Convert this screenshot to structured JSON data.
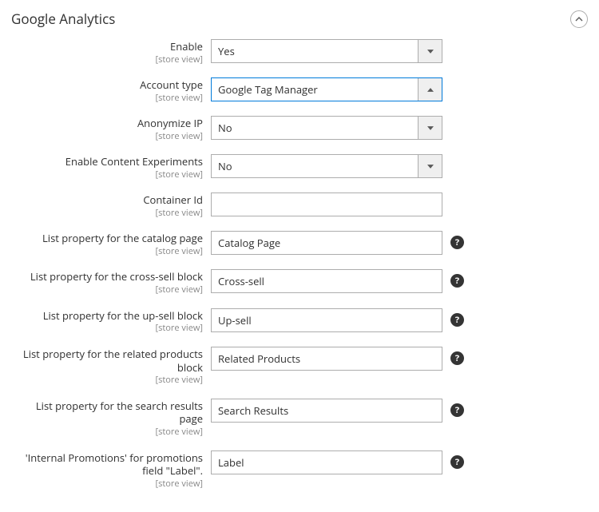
{
  "section": {
    "title": "Google Analytics"
  },
  "scope_text": "[store view]",
  "fields": {
    "enable": {
      "label": "Enable",
      "value": "Yes"
    },
    "account_type": {
      "label": "Account type",
      "value": "Google Tag Manager"
    },
    "anonymize_ip": {
      "label": "Anonymize IP",
      "value": "No"
    },
    "enable_content_experiments": {
      "label": "Enable Content Experiments",
      "value": "No"
    },
    "container_id": {
      "label": "Container Id",
      "value": ""
    },
    "list_catalog": {
      "label": "List property for the catalog page",
      "value": "Catalog Page"
    },
    "list_cross_sell": {
      "label": "List property for the cross-sell block",
      "value": "Cross-sell"
    },
    "list_up_sell": {
      "label": "List property for the up-sell block",
      "value": "Up-sell"
    },
    "list_related": {
      "label": "List property for the related products block",
      "value": "Related Products"
    },
    "list_search": {
      "label": "List property for the search results page",
      "value": "Search Results"
    },
    "internal_promos": {
      "label": "'Internal Promotions' for promotions field \"Label\".",
      "value": "Label"
    }
  }
}
